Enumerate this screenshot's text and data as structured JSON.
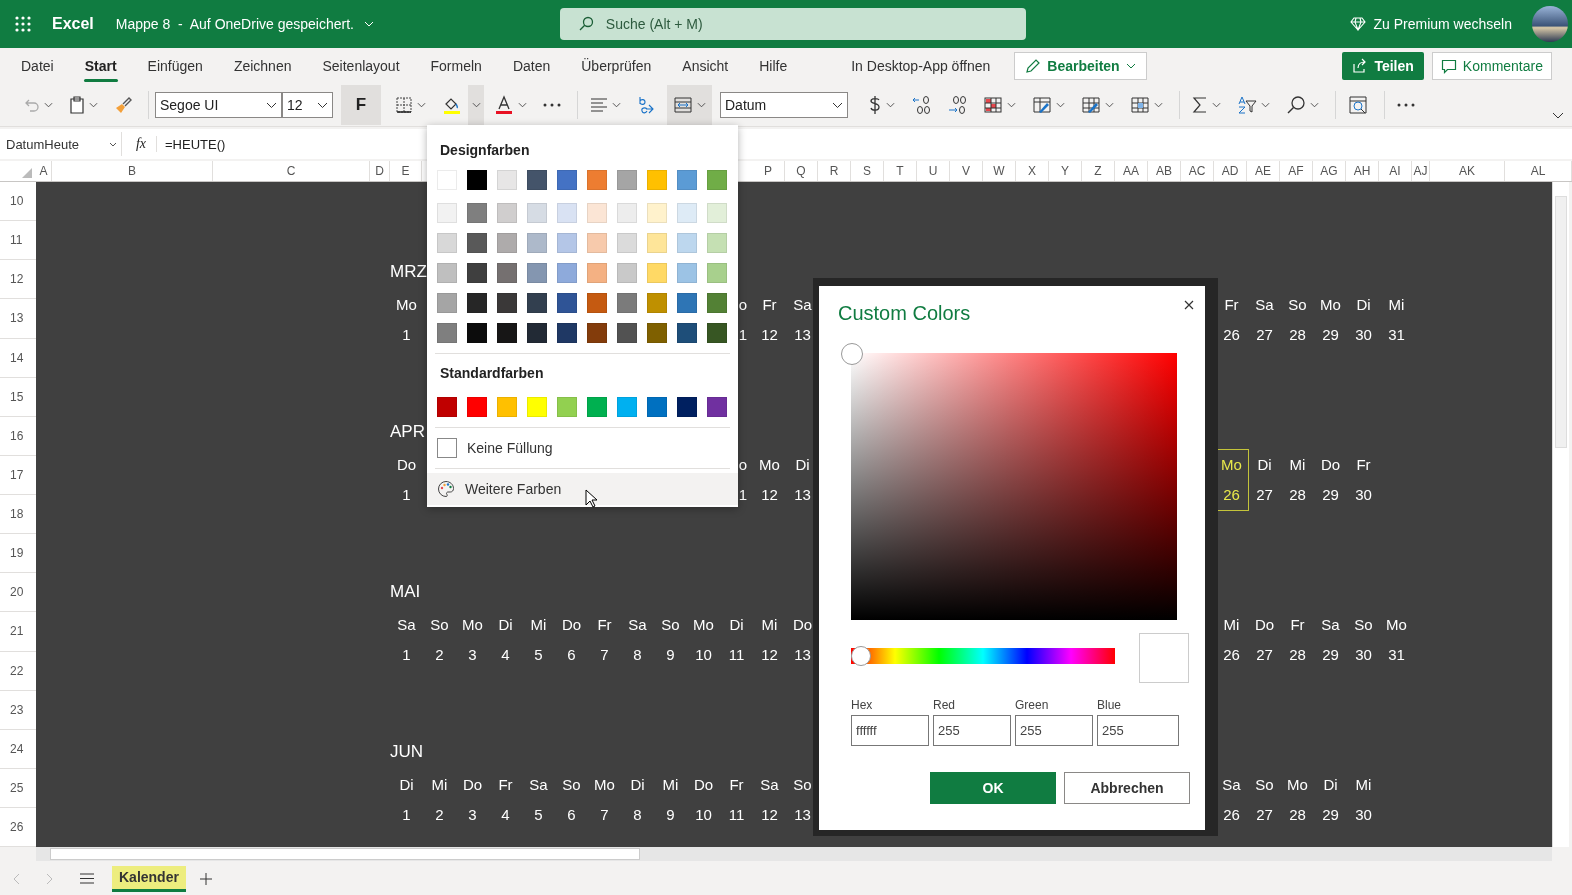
{
  "app_bar": {
    "app_name": "Excel",
    "document_title": "Mappe 8  -  Auf OneDrive gespeichert.",
    "search": {
      "placeholder": "Suche (Alt + M)"
    },
    "premium_link": "Zu Premium wechseln"
  },
  "ribbon_tabs": [
    {
      "label": "Datei",
      "selected": false
    },
    {
      "label": "Start",
      "selected": true
    },
    {
      "label": "Einfügen",
      "selected": false
    },
    {
      "label": "Zeichnen",
      "selected": false
    },
    {
      "label": "Seitenlayout",
      "selected": false
    },
    {
      "label": "Formeln",
      "selected": false
    },
    {
      "label": "Daten",
      "selected": false
    },
    {
      "label": "Überprüfen",
      "selected": false
    },
    {
      "label": "Ansicht",
      "selected": false
    },
    {
      "label": "Hilfe",
      "selected": false
    }
  ],
  "ribbon_actions": {
    "open_desktop": "In Desktop-App öffnen",
    "edit_mode": "Bearbeiten",
    "share": "Teilen",
    "comments": "Kommentare"
  },
  "toolbar": {
    "font": "Segoe UI",
    "font_size": "12",
    "bold": {
      "label": "F",
      "on": true
    },
    "fill_color": {
      "expanded": true
    },
    "merge_center": {
      "on": true
    },
    "number_format": "Datum"
  },
  "formula_bar": {
    "name_box": "DatumHeute",
    "fx": "fx",
    "formula": "=HEUTE()"
  },
  "columns_left": [
    "A",
    "B",
    "C",
    "D",
    "E"
  ],
  "columns_right": [
    "P",
    "Q",
    "R",
    "S",
    "T",
    "U",
    "V",
    "W",
    "X",
    "Y",
    "Z",
    "AA",
    "AB",
    "AC",
    "AD",
    "AE",
    "AF",
    "AG",
    "AH",
    "AI",
    "AJ",
    "AK",
    "AL"
  ],
  "rows": [
    "10",
    "11",
    "12",
    "13",
    "14",
    "15",
    "16",
    "17",
    "18",
    "19",
    "20",
    "21",
    "22",
    "23",
    "24",
    "25",
    "26"
  ],
  "calendar": [
    {
      "month": "MRZ",
      "start": [
        {
          "weekday": "Mo",
          "day": "1",
          "today": false
        }
      ],
      "mid": [
        {
          "weekday": "o",
          "day": "1",
          "today": false
        },
        {
          "weekday": "Fr",
          "day": "12",
          "today": false
        },
        {
          "weekday": "Sa",
          "day": "13",
          "today": false
        }
      ],
      "end": [
        {
          "weekday": "Fr",
          "day": "26",
          "today": false
        },
        {
          "weekday": "Sa",
          "day": "27",
          "today": false
        },
        {
          "weekday": "So",
          "day": "28",
          "today": false
        },
        {
          "weekday": "Mo",
          "day": "29",
          "today": false
        },
        {
          "weekday": "Di",
          "day": "30",
          "today": false
        },
        {
          "weekday": "Mi",
          "day": "31",
          "today": false
        }
      ]
    },
    {
      "month": "APR",
      "start": [
        {
          "weekday": "Do",
          "day": "1",
          "today": false
        }
      ],
      "mid": [
        {
          "weekday": "o",
          "day": "1",
          "today": false
        },
        {
          "weekday": "Mo",
          "day": "12",
          "today": false
        },
        {
          "weekday": "Di",
          "day": "13",
          "today": false
        }
      ],
      "end": [
        {
          "weekday": "Mo",
          "day": "26",
          "today": true
        },
        {
          "weekday": "Di",
          "day": "27",
          "today": false
        },
        {
          "weekday": "Mi",
          "day": "28",
          "today": false
        },
        {
          "weekday": "Do",
          "day": "29",
          "today": false
        },
        {
          "weekday": "Fr",
          "day": "30",
          "today": false
        }
      ]
    },
    {
      "month": "MAI",
      "start": [
        {
          "weekday": "Sa",
          "day": "1",
          "today": false
        },
        {
          "weekday": "So",
          "day": "2",
          "today": false
        },
        {
          "weekday": "Mo",
          "day": "3",
          "today": false
        },
        {
          "weekday": "Di",
          "day": "4",
          "today": false
        },
        {
          "weekday": "Mi",
          "day": "5",
          "today": false
        },
        {
          "weekday": "Do",
          "day": "6",
          "today": false
        },
        {
          "weekday": "Fr",
          "day": "7",
          "today": false
        },
        {
          "weekday": "Sa",
          "day": "8",
          "today": false
        },
        {
          "weekday": "So",
          "day": "9",
          "today": false
        },
        {
          "weekday": "Mo",
          "day": "10",
          "today": false
        },
        {
          "weekday": "Di",
          "day": "11",
          "today": false
        },
        {
          "weekday": "Mi",
          "day": "12",
          "today": false
        },
        {
          "weekday": "Do",
          "day": "13",
          "today": false
        }
      ],
      "end": [
        {
          "weekday": "Mi",
          "day": "26",
          "today": false
        },
        {
          "weekday": "Do",
          "day": "27",
          "today": false
        },
        {
          "weekday": "Fr",
          "day": "28",
          "today": false
        },
        {
          "weekday": "Sa",
          "day": "29",
          "today": false
        },
        {
          "weekday": "So",
          "day": "30",
          "today": false
        },
        {
          "weekday": "Mo",
          "day": "31",
          "today": false
        }
      ]
    },
    {
      "month": "JUN",
      "start": [
        {
          "weekday": "Di",
          "day": "1",
          "today": false
        },
        {
          "weekday": "Mi",
          "day": "2",
          "today": false
        },
        {
          "weekday": "Do",
          "day": "3",
          "today": false
        },
        {
          "weekday": "Fr",
          "day": "4",
          "today": false
        },
        {
          "weekday": "Sa",
          "day": "5",
          "today": false
        },
        {
          "weekday": "So",
          "day": "6",
          "today": false
        },
        {
          "weekday": "Mo",
          "day": "7",
          "today": false
        },
        {
          "weekday": "Di",
          "day": "8",
          "today": false
        },
        {
          "weekday": "Mi",
          "day": "9",
          "today": false
        },
        {
          "weekday": "Do",
          "day": "10",
          "today": false
        },
        {
          "weekday": "Fr",
          "day": "11",
          "today": false
        },
        {
          "weekday": "Sa",
          "day": "12",
          "today": false
        },
        {
          "weekday": "So",
          "day": "13",
          "today": false
        }
      ],
      "end": [
        {
          "weekday": "Sa",
          "day": "26",
          "today": false
        },
        {
          "weekday": "So",
          "day": "27",
          "today": false
        },
        {
          "weekday": "Mo",
          "day": "28",
          "today": false
        },
        {
          "weekday": "Di",
          "day": "29",
          "today": false
        },
        {
          "weekday": "Mi",
          "day": "30",
          "today": false
        }
      ]
    }
  ],
  "fill_color_menu": {
    "theme_title": "Designfarben",
    "theme_rows": [
      [
        {
          "color": "#ffffff"
        },
        {
          "color": "#000000"
        },
        {
          "color": "#e7e6e6"
        },
        {
          "color": "#44546a"
        },
        {
          "color": "#4472c4"
        },
        {
          "color": "#ed7d31"
        },
        {
          "color": "#a5a5a5"
        },
        {
          "color": "#ffc000"
        },
        {
          "color": "#5b9bd5"
        },
        {
          "color": "#70ad47"
        }
      ],
      [
        {
          "color": "#f2f2f2"
        },
        {
          "color": "#7f7f7f"
        },
        {
          "color": "#d0cece"
        },
        {
          "color": "#d6dce4"
        },
        {
          "color": "#d9e2f3"
        },
        {
          "color": "#fbe5d5"
        },
        {
          "color": "#ededed"
        },
        {
          "color": "#fff2cc"
        },
        {
          "color": "#deebf6"
        },
        {
          "color": "#e2efd9"
        }
      ],
      [
        {
          "color": "#d8d8d8"
        },
        {
          "color": "#595959"
        },
        {
          "color": "#aeabab"
        },
        {
          "color": "#adb9ca"
        },
        {
          "color": "#b4c6e7"
        },
        {
          "color": "#f7caac"
        },
        {
          "color": "#dbdbdb"
        },
        {
          "color": "#fee599"
        },
        {
          "color": "#bdd7ee"
        },
        {
          "color": "#c5e0b3"
        }
      ],
      [
        {
          "color": "#bfbfbf"
        },
        {
          "color": "#3f3f3f"
        },
        {
          "color": "#757070"
        },
        {
          "color": "#8496b0"
        },
        {
          "color": "#8eaadb"
        },
        {
          "color": "#f4b183"
        },
        {
          "color": "#c9c9c9"
        },
        {
          "color": "#ffd965"
        },
        {
          "color": "#9cc3e5"
        },
        {
          "color": "#a8d08d"
        }
      ],
      [
        {
          "color": "#a5a5a5"
        },
        {
          "color": "#262626"
        },
        {
          "color": "#3a3838"
        },
        {
          "color": "#323f4f"
        },
        {
          "color": "#2f5496"
        },
        {
          "color": "#c55a11"
        },
        {
          "color": "#7b7b7b"
        },
        {
          "color": "#bf9000"
        },
        {
          "color": "#2e75b5"
        },
        {
          "color": "#538135"
        }
      ],
      [
        {
          "color": "#7f7f7f"
        },
        {
          "color": "#0c0c0c"
        },
        {
          "color": "#171616"
        },
        {
          "color": "#222a35"
        },
        {
          "color": "#1f3864"
        },
        {
          "color": "#833c0b"
        },
        {
          "color": "#525252"
        },
        {
          "color": "#7f6000"
        },
        {
          "color": "#1e4e79"
        },
        {
          "color": "#375623"
        }
      ]
    ],
    "standard_title": "Standardfarben",
    "standard_colors": [
      {
        "color": "#c00000"
      },
      {
        "color": "#ff0000"
      },
      {
        "color": "#ffc000"
      },
      {
        "color": "#ffff00"
      },
      {
        "color": "#92d050"
      },
      {
        "color": "#00b050"
      },
      {
        "color": "#00b0f0"
      },
      {
        "color": "#0070c0"
      },
      {
        "color": "#002060"
      },
      {
        "color": "#7030a0"
      }
    ],
    "no_fill": "Keine Füllung",
    "more_colors": {
      "label": "Weitere Farben",
      "hovered": true
    }
  },
  "dialog": {
    "title": "Custom Colors",
    "hue_slider": {
      "level": 0
    },
    "fields": [
      {
        "label": "Hex",
        "value": "ffffff"
      },
      {
        "label": "Red",
        "value": "255"
      },
      {
        "label": "Green",
        "value": "255"
      },
      {
        "label": "Blue",
        "value": "255"
      }
    ],
    "ok": "OK",
    "cancel": "Abbrechen"
  },
  "sheet_tabs": [
    {
      "label": "Kalender",
      "selected": true
    }
  ]
}
